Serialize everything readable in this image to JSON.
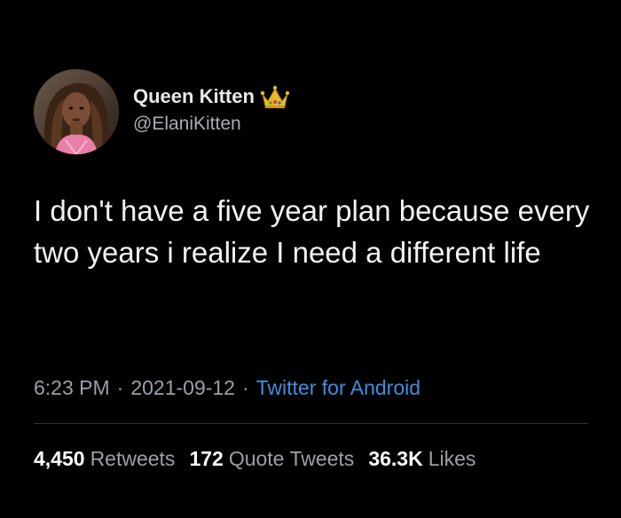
{
  "tweet": {
    "author": {
      "display_name": "Queen Kitten",
      "handle": "@ElaniKitten",
      "badge_icon": "crown-icon"
    },
    "text": "I don't have a five year plan because every two years i realize I need a different life",
    "meta": {
      "time": "6:23 PM",
      "date": "2021-09-12",
      "separator": "·",
      "source": "Twitter for Android"
    },
    "stats": [
      {
        "count": "4,450",
        "label": "Retweets"
      },
      {
        "count": "172",
        "label": "Quote Tweets"
      },
      {
        "count": "36.3K",
        "label": "Likes"
      }
    ]
  },
  "colors": {
    "background": "#000000",
    "text_primary": "#e7e9ea",
    "text_secondary": "#9aa0a6",
    "link": "#3f8ee0",
    "divider": "#2f3336"
  }
}
